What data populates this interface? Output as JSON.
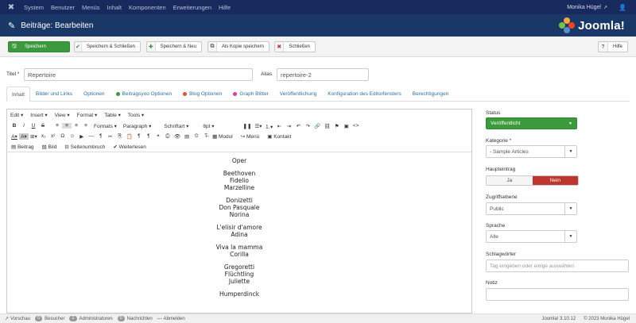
{
  "topnav": {
    "menu": [
      "System",
      "Benutzer",
      "Menüs",
      "Inhalt",
      "Komponenten",
      "Erweiterungen",
      "Hilfe"
    ],
    "user": "Monika Hügel"
  },
  "header": {
    "title": "Beiträge: Bearbeiten",
    "brand": "Joomla!",
    "brand_colors": [
      "#f9a541",
      "#f44321",
      "#5091cd",
      "#7ac143"
    ]
  },
  "toolbar": {
    "save": "Speichern",
    "save_close": "Speichern & Schließen",
    "save_new": "Speichern & Neu",
    "save_copy": "Als Kopie speichern",
    "close": "Schließen",
    "help": "Hilfe"
  },
  "form": {
    "title_label": "Titel *",
    "title_value": "Repertoire",
    "alias_label": "Alias",
    "alias_value": "repertoire-2"
  },
  "tabs": [
    {
      "label": "Inhalt",
      "dot": ""
    },
    {
      "label": "Bilder und Links",
      "dot": ""
    },
    {
      "label": "Optionen",
      "dot": ""
    },
    {
      "label": "Beitragsyoo Optionen",
      "dot": "#3b9a3b"
    },
    {
      "label": "Blog Optionen",
      "dot": "#e0533a"
    },
    {
      "label": "Graph Blitter",
      "dot": "#d43ea8"
    },
    {
      "label": "Veröffentlichung",
      "dot": ""
    },
    {
      "label": "Konfiguration des Editorfensters",
      "dot": ""
    },
    {
      "label": "Berechtigungen",
      "dot": ""
    }
  ],
  "editor": {
    "menus": [
      "Edit ▾",
      "Insert ▾",
      "View ▾",
      "Format ▾",
      "Table ▾",
      "Tools ▾"
    ],
    "formats_label": "Formats ▾",
    "paragraph_label": "Paragraph ▾",
    "fontfamily_label": "Schriftart ▾",
    "fontsize_label": "8pt ▾",
    "modul_label": "Modul",
    "menu_label": "Menü",
    "kontakt_label": "Kontakt",
    "beitrag_label": "Beitrag",
    "bild_label": "Bild",
    "seitenumbruch_label": "Seitenumbruch",
    "weiterlesen_label": "Weiterlesen",
    "content": [
      [
        "Oper"
      ],
      [
        "Beethoven",
        "Fidelio",
        "Marzelline"
      ],
      [
        "Donizetti",
        "Don Pasquale",
        "Norina"
      ],
      [
        "L'elisir d'amore",
        "Adina"
      ],
      [
        "Viva la mamma",
        "Corilla"
      ],
      [
        "Gregoretti",
        "Flüchtling",
        "Juliette"
      ],
      [
        "Humperdinck"
      ]
    ]
  },
  "sidebar": {
    "status_label": "Status",
    "status_value": "Veröffentlicht",
    "category_label": "Kategorie *",
    "category_value": "- Sample Articles",
    "featured_label": "Haupteintrag",
    "featured_yes": "Ja",
    "featured_no": "Nein",
    "access_label": "Zugriffsebene",
    "access_value": "Public",
    "language_label": "Sprache",
    "language_value": "Alle",
    "tags_label": "Schlagwörter",
    "tags_placeholder": "Tag eingeben oder einige auswählen",
    "note_label": "Notiz"
  },
  "statusbar": {
    "preview": "Vorschau",
    "visitors_count": "0",
    "visitors": "Besucher",
    "admins_count": "2",
    "admins": "Administratoren",
    "messages_count": "0",
    "messages": "Nachrichten",
    "logout": "Abmelden",
    "version": "Joomla! 3.10.12",
    "copyright": "© 2023 Monika Hügel"
  }
}
